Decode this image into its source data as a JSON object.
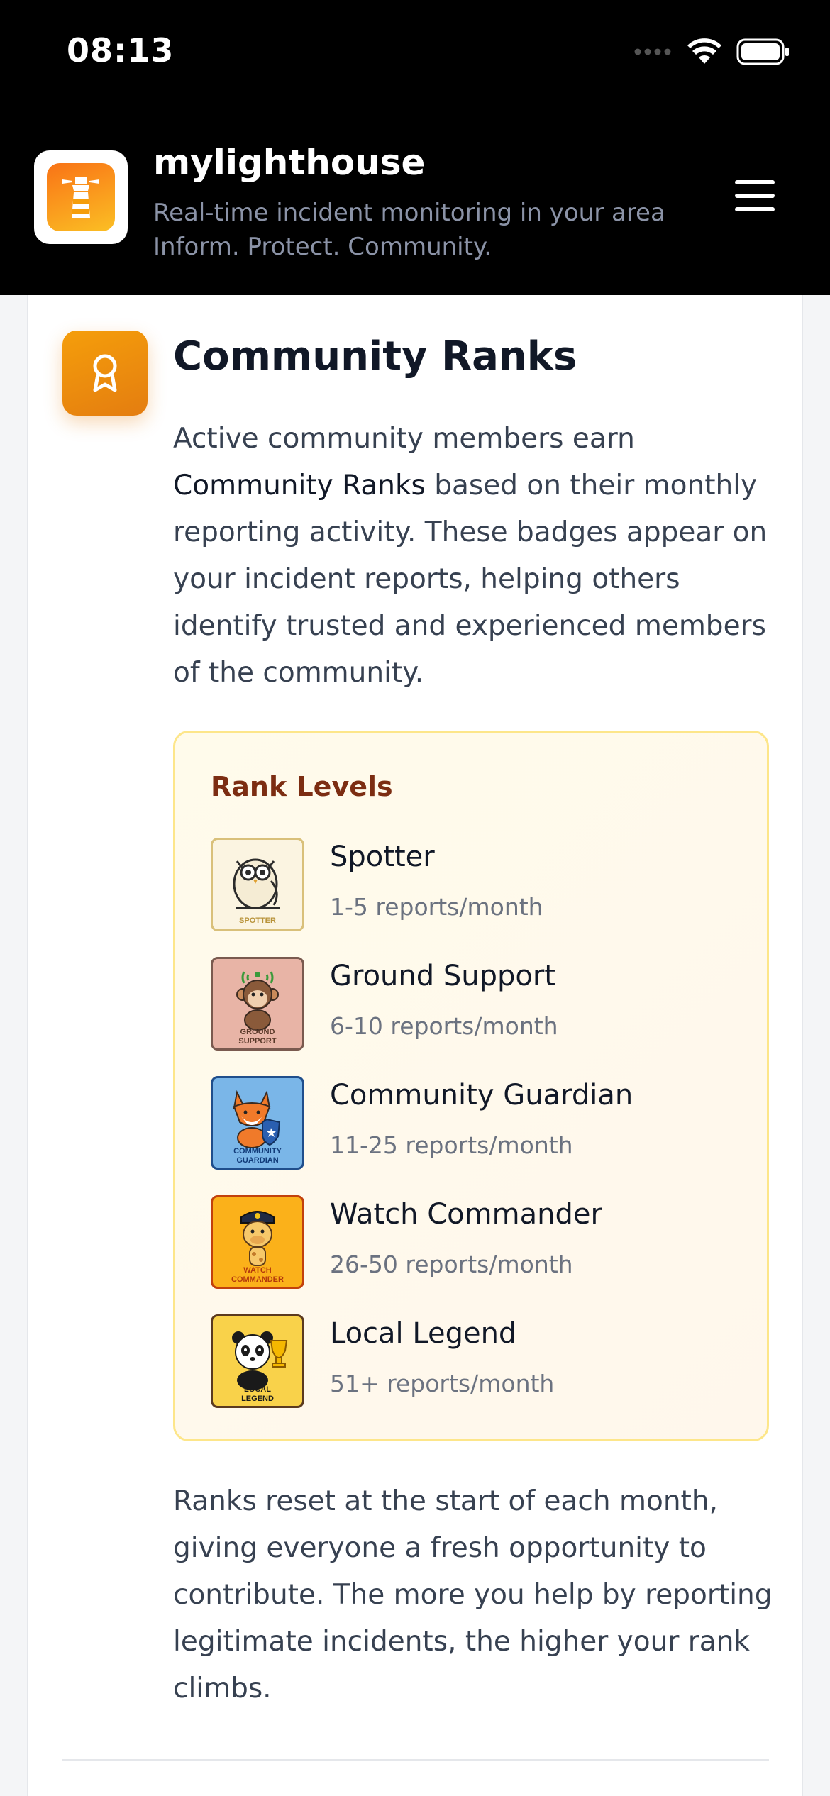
{
  "status_bar": {
    "time": "08:13"
  },
  "header": {
    "app_name": "mylighthouse",
    "tagline_1": "Real-time incident monitoring in your area",
    "tagline_2": "Inform. Protect. Community."
  },
  "section": {
    "title": "Community Ranks",
    "intro_1": "Active community members earn ",
    "intro_bold": "Community Ranks",
    "intro_2": " based on their monthly reporting activity. These badges appear on your incident reports, helping others identify trusted and experienced members of the community.",
    "rank_heading": "Rank Levels",
    "ranks": [
      {
        "name": "Spotter",
        "range": "1-5 reports/month",
        "badge_label": "SPOTTER",
        "badge_bg": "#fbf4e1",
        "badge_border": "#d9c07a"
      },
      {
        "name": "Ground Support",
        "range": "6-10 reports/month",
        "badge_label": "GROUND SUPPORT",
        "badge_bg": "#e8b4a6",
        "badge_border": "#7a5a4f"
      },
      {
        "name": "Community Guardian",
        "range": "11-25 reports/month",
        "badge_label": "COMMUNITY GUARDIAN",
        "badge_bg": "#7ab6e8",
        "badge_border": "#1f4e8c"
      },
      {
        "name": "Watch Commander",
        "range": "26-50 reports/month",
        "badge_label": "WATCH COMMANDER",
        "badge_bg": "#fbb11a",
        "badge_border": "#c2410c"
      },
      {
        "name": "Local Legend",
        "range": "51+ reports/month",
        "badge_label": "LOCAL LEGEND",
        "badge_bg": "#f9d24a",
        "badge_border": "#5b3a1f"
      }
    ],
    "outro": "Ranks reset at the start of each month, giving everyone a fresh opportunity to contribute. The more you help by reporting legitimate incidents, the higher your rank climbs."
  },
  "icons": {
    "logo": "lighthouse-icon",
    "menu": "hamburger-menu-icon",
    "section": "award-ribbon-icon"
  },
  "colors": {
    "accent": "#f59e0b",
    "header_bg": "#000000",
    "rank_box_bg": "#fffbeb",
    "rank_box_border": "#fde68a",
    "rank_heading": "#7c2d12"
  }
}
